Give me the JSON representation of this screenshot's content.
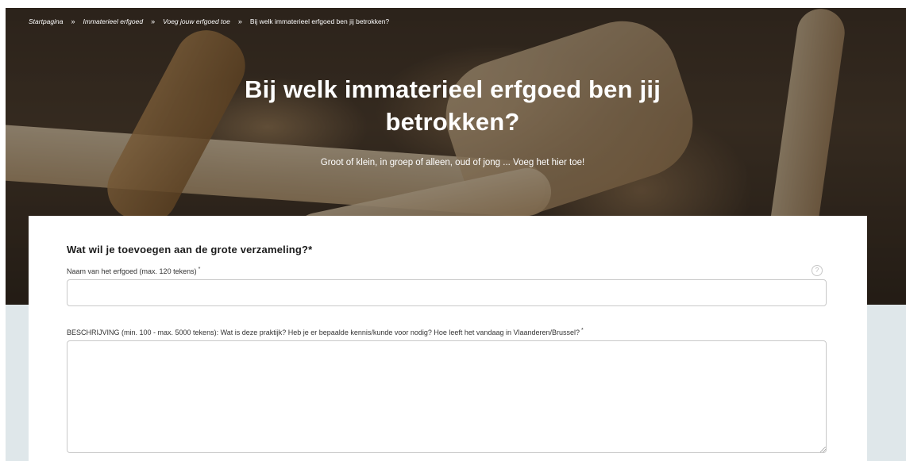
{
  "breadcrumb": {
    "items": [
      {
        "label": "Startpagina"
      },
      {
        "label": "Immaterieel erfgoed"
      },
      {
        "label": "Voeg jouw erfgoed toe"
      }
    ],
    "current": "Bij welk immaterieel erfgoed ben jij betrokken?",
    "separator": "»"
  },
  "hero": {
    "title_line1": "Bij welk immaterieel erfgoed ben jij",
    "title_line2": "betrokken?",
    "subtitle": "Groot of klein, in groep of alleen, oud of jong ... Voeg het hier toe!"
  },
  "form": {
    "section_title": "Wat wil je toevoegen aan de grote verzameling?*",
    "name_field": {
      "label": "Naam van het erfgoed (max. 120 tekens)",
      "required_mark": "*",
      "value": "",
      "help_icon": "question-circle-icon",
      "help_glyph": "?"
    },
    "description_field": {
      "label": "BESCHRIJVING (min. 100 - max. 5000 tekens): Wat is deze praktijk? Heb je er bepaalde kennis/kunde voor nodig? Hoe leeft het vandaag in Vlaanderen/Brussel?",
      "required_mark": "*",
      "value": ""
    }
  },
  "colors": {
    "band": "#dfe7ea",
    "card": "#ffffff",
    "input_border": "#c9c9c9"
  }
}
